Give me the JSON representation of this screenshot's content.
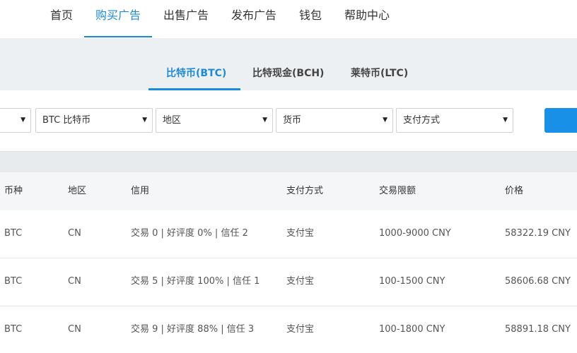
{
  "nav": {
    "items": [
      {
        "label": "首页"
      },
      {
        "label": "购买广告"
      },
      {
        "label": "出售广告"
      },
      {
        "label": "发布广告"
      },
      {
        "label": "钱包"
      },
      {
        "label": "帮助中心"
      }
    ],
    "active_index": 1,
    "accent_color": "#1b8bd8"
  },
  "coin_tabs": [
    {
      "label": "比特币(BTC)"
    },
    {
      "label": "比特现金(BCH)"
    },
    {
      "label": "莱特币(LTC)"
    }
  ],
  "filters": {
    "coin_select": "BTC 比特币",
    "region_select": "地区",
    "currency_select": "货币",
    "payment_select": "支付方式",
    "caret": "▼"
  },
  "table": {
    "headers": {
      "coin": "币种",
      "region": "地区",
      "credit": "信用",
      "payment": "支付方式",
      "limit": "交易限额",
      "price": "价格"
    },
    "rows": [
      {
        "coin": "BTC",
        "region": "CN",
        "credit": "交易 0 | 好评度 0% | 信任 2",
        "payment": "支付宝",
        "limit": "1000-9000 CNY",
        "price": "58322.19 CNY"
      },
      {
        "coin": "BTC",
        "region": "CN",
        "credit": "交易 5 | 好评度 100% | 信任 1",
        "payment": "支付宝",
        "limit": "100-1500 CNY",
        "price": "58606.68 CNY"
      },
      {
        "coin": "BTC",
        "region": "CN",
        "credit": "交易 9 | 好评度 88% | 信任 3",
        "payment": "支付宝",
        "limit": "100-1800 CNY",
        "price": "58891.18 CNY"
      }
    ]
  }
}
